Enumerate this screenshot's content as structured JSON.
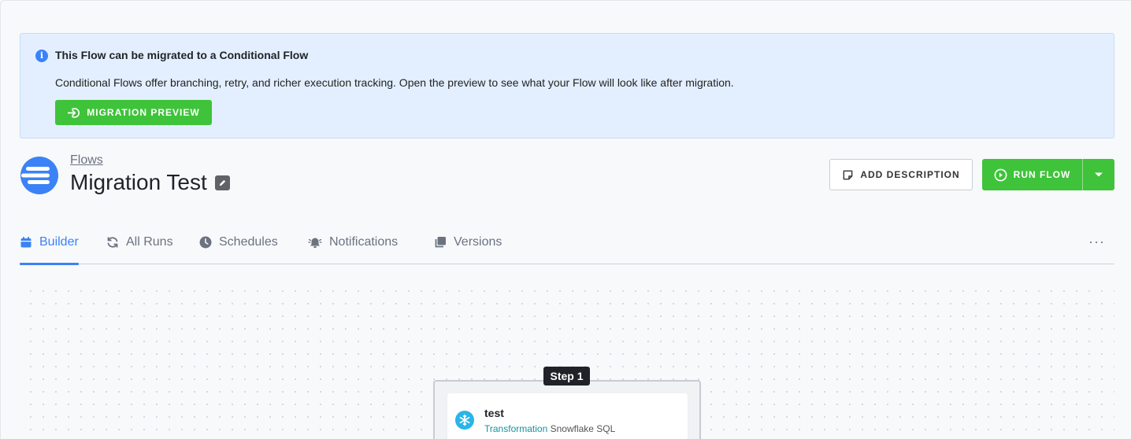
{
  "banner": {
    "title": "This Flow can be migrated to a Conditional Flow",
    "text": "Conditional Flows offer branching, retry, and richer execution tracking. Open the preview to see what your Flow will look like after migration.",
    "button_label": "MIGRATION PREVIEW"
  },
  "header": {
    "breadcrumb": "Flows",
    "title": "Migration Test",
    "add_description_label": "ADD DESCRIPTION",
    "run_flow_label": "RUN FLOW"
  },
  "tabs": [
    {
      "label": "Builder",
      "icon": "calendar-icon",
      "active": true
    },
    {
      "label": "All Runs",
      "icon": "refresh-icon",
      "active": false
    },
    {
      "label": "Schedules",
      "icon": "clock-icon",
      "active": false
    },
    {
      "label": "Notifications",
      "icon": "bell-icon",
      "active": false
    },
    {
      "label": "Versions",
      "icon": "versions-icon",
      "active": false
    }
  ],
  "more_label": "···",
  "canvas": {
    "step_label": "Step 1",
    "task": {
      "name": "test",
      "type": "Transformation",
      "component": "Snowflake SQL",
      "icon": "snowflake-icon"
    }
  },
  "colors": {
    "accent": "#3b82f6",
    "success": "#3fc33a",
    "banner_bg": "#e3efff",
    "transformation": "#16919d"
  }
}
